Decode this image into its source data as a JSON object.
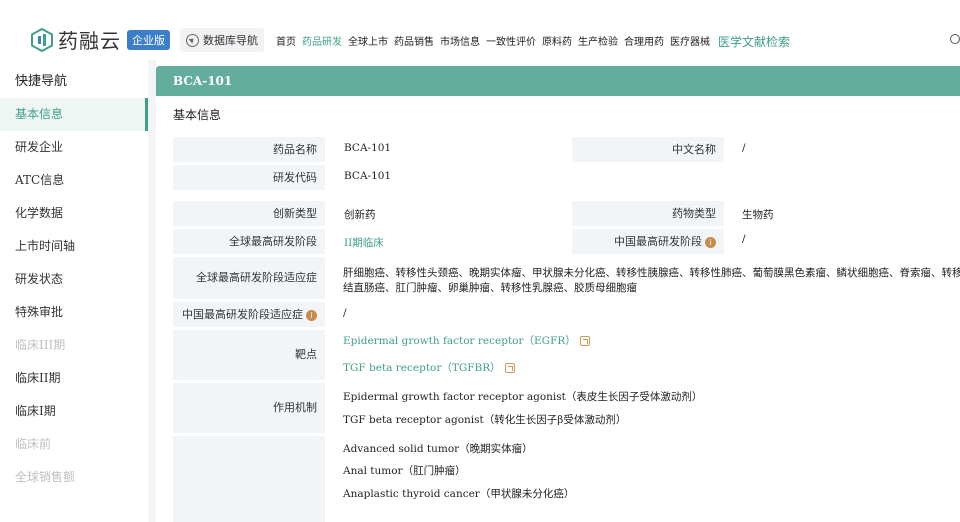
{
  "header": {
    "logo_text": "药融云",
    "logo_badge": "企业版",
    "db_nav_label": "数据库导航",
    "menu": [
      {
        "label": "首页",
        "active": false
      },
      {
        "label": "药品研发",
        "active": true
      },
      {
        "label": "全球上市",
        "active": false
      },
      {
        "label": "药品销售",
        "active": false
      },
      {
        "label": "市场信息",
        "active": false
      },
      {
        "label": "一致性评价",
        "active": false
      },
      {
        "label": "原料药",
        "active": false
      },
      {
        "label": "生产检验",
        "active": false
      },
      {
        "label": "合理用药",
        "active": false
      },
      {
        "label": "医疗器械",
        "active": false
      }
    ],
    "literature_search": "医学文献检索",
    "accent_color": "#3f9f8c",
    "badge_color": "#3b7ec9"
  },
  "sidebar": {
    "title": "快捷导航",
    "items": [
      {
        "label": "基本信息",
        "state": "active"
      },
      {
        "label": "研发企业",
        "state": "normal"
      },
      {
        "label": "ATC信息",
        "state": "normal"
      },
      {
        "label": "化学数据",
        "state": "normal"
      },
      {
        "label": "上市时间轴",
        "state": "normal"
      },
      {
        "label": "研发状态",
        "state": "normal"
      },
      {
        "label": "特殊审批",
        "state": "normal"
      },
      {
        "label": "临床III期",
        "state": "disabled"
      },
      {
        "label": "临床II期",
        "state": "normal"
      },
      {
        "label": "临床I期",
        "state": "normal"
      },
      {
        "label": "临床前",
        "state": "disabled"
      },
      {
        "label": "全球销售额",
        "state": "disabled"
      }
    ]
  },
  "main": {
    "drug_title": "BCA-101",
    "section_title": "基本信息",
    "fields": {
      "drug_name_label": "药品名称",
      "drug_name_value": "BCA-101",
      "cn_name_label": "中文名称",
      "cn_name_value": "/",
      "rd_code_label": "研发代码",
      "rd_code_value": "BCA-101",
      "innovation_label": "创新类型",
      "innovation_value": "创新药",
      "drug_type_label": "药物类型",
      "drug_type_value": "生物药",
      "global_stage_label": "全球最高研发阶段",
      "global_stage_value": "II期临床",
      "china_stage_label": "中国最高研发阶段",
      "china_stage_value": "/",
      "global_indication_label": "全球最高研发阶段适应症",
      "global_indication_line1": "肝细胞癌、转移性头颈癌、晚期实体瘤、甲状腺未分化癌、转移性胰腺癌、转移性肺癌、葡萄膜黑色素瘤、鳞状细胞癌、脊索瘤、转移性",
      "global_indication_line2": "结直肠癌、肛门肿瘤、卵巢肿瘤、转移性乳腺癌、胶质母细胞瘤",
      "china_indication_label": "中国最高研发阶段适应症",
      "china_indication_value": "/",
      "target_label": "靶点",
      "targets": [
        "Epidermal growth factor receptor（EGFR）",
        "TGF beta receptor（TGFBR）"
      ],
      "mechanism_label": "作用机制",
      "mechanisms": [
        "Epidermal growth factor receptor agonist（表皮生长因子受体激动剂）",
        "TGF beta receptor agonist（转化生长因子β受体激动剂）"
      ],
      "indications": [
        "Advanced solid tumor（晚期实体瘤）",
        "Anal tumor（肛门肿瘤）",
        "Anaplastic thyroid cancer（甲状腺未分化癌）"
      ]
    }
  }
}
